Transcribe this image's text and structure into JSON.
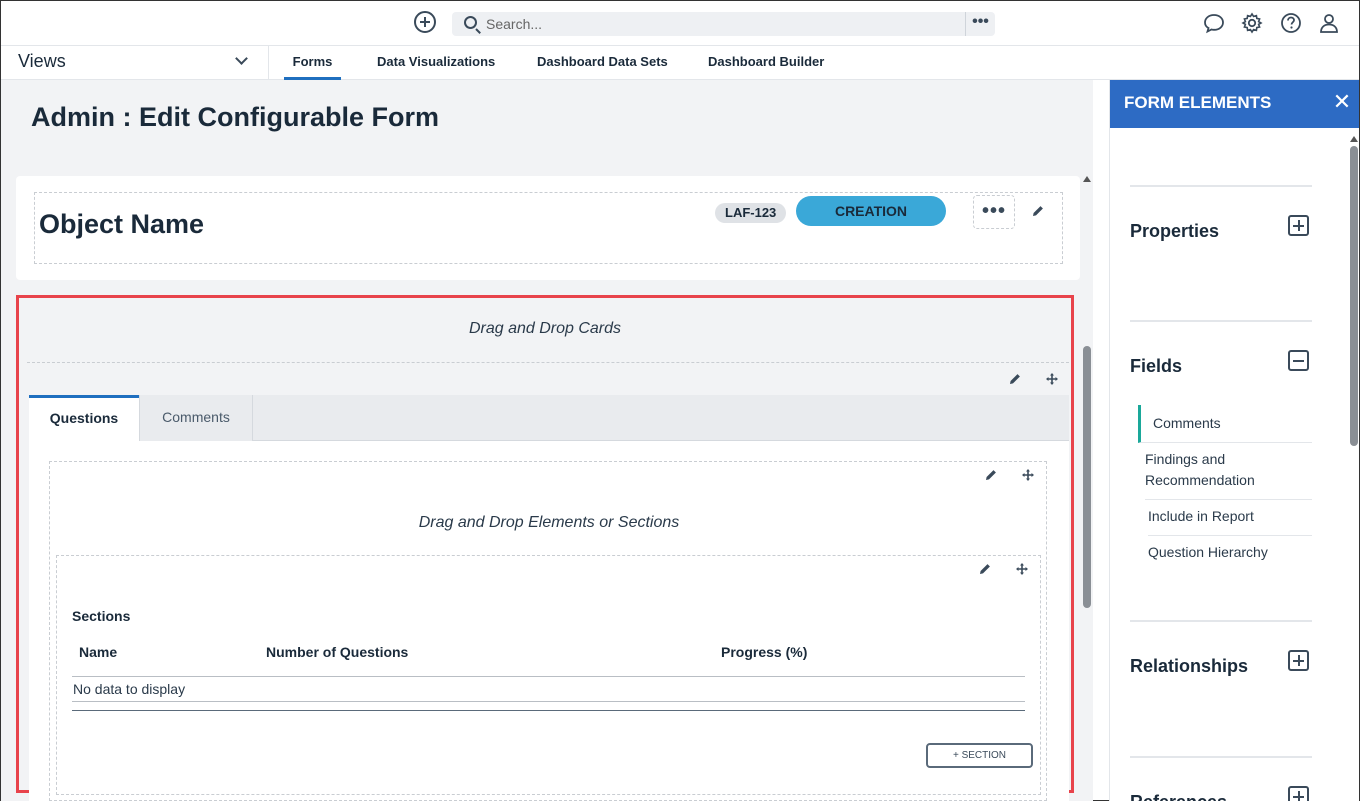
{
  "search": {
    "placeholder": "Search...",
    "more": "•••"
  },
  "nav": {
    "views_label": "Views",
    "tabs": [
      {
        "label": "Forms"
      },
      {
        "label": "Data Visualizations"
      },
      {
        "label": "Dashboard Data Sets"
      },
      {
        "label": "Dashboard Builder"
      }
    ]
  },
  "page": {
    "title": "Admin : Edit Configurable Form"
  },
  "header_card": {
    "object_name": "Object Name",
    "id_badge": "LAF-123",
    "status": "CREATION",
    "more": "•••"
  },
  "cards": {
    "drag_drop_cards": "Drag and Drop Cards",
    "tabs": [
      {
        "label": "Questions"
      },
      {
        "label": "Comments"
      }
    ],
    "drag_drop_elements": "Drag and Drop Elements or Sections",
    "sections": {
      "title": "Sections",
      "columns": [
        "Name",
        "Number of Questions",
        "Progress (%)"
      ],
      "empty_text": "No data to display",
      "add_button": "+ SECTION"
    }
  },
  "right_panel": {
    "title": "FORM ELEMENTS",
    "close": "✕",
    "groups": {
      "properties": "Properties",
      "fields": "Fields",
      "relationships": "Relationships",
      "references": "References"
    },
    "fields": [
      "Comments",
      "Findings and Recommendation",
      "Include in Report",
      "Question Hierarchy"
    ]
  },
  "colors": {
    "accent": "#2d6bc4",
    "status_pill": "#3aa8d8",
    "highlight_border": "#e8434b",
    "selected_field": "#1aa89a"
  }
}
